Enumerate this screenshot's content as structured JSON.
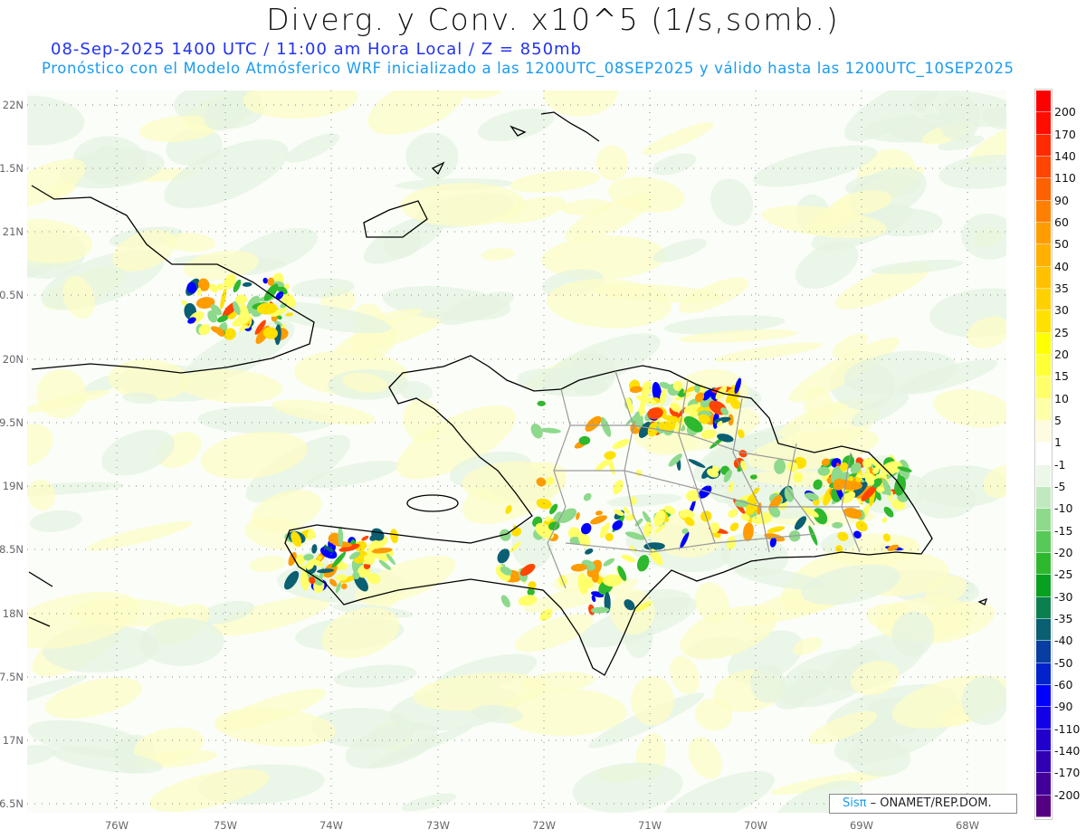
{
  "header": {
    "title": "Diverg. y Conv. x10^5 (1/s,somb.)",
    "subtitle": "08-Sep-2025  1400 UTC / 11:00 am Hora Local / Z = 850mb",
    "model_line": "Pronóstico con el Modelo Atmósferico WRF inicializado a las 1200UTC_08SEP2025 y válido hasta las  1200UTC_10SEP2025"
  },
  "axes": {
    "lat_labels": [
      "22N",
      "1.5N",
      "21N",
      "0.5N",
      "20N",
      "9.5N",
      "19N",
      "8.5N",
      "18N",
      "7.5N",
      "17N",
      "6.5N"
    ],
    "lon_labels": [
      "76W",
      "75W",
      "74W",
      "73W",
      "72W",
      "71W",
      "70W",
      "69W",
      "68W"
    ]
  },
  "colorbar": {
    "labels": [
      "200",
      "170",
      "140",
      "110",
      "90",
      "60",
      "50",
      "40",
      "35",
      "30",
      "25",
      "20",
      "15",
      "10",
      "5",
      "1",
      "-1",
      "-5",
      "-10",
      "-15",
      "-20",
      "-25",
      "-30",
      "-35",
      "-40",
      "-50",
      "-60",
      "-90",
      "-110",
      "-140",
      "-170",
      "-200"
    ],
    "colors": [
      "#ff0000",
      "#ff0d00",
      "#ff2a00",
      "#ff4500",
      "#ff6000",
      "#ff8000",
      "#ff9c00",
      "#ffb000",
      "#ffc000",
      "#ffd000",
      "#ffe000",
      "#ffff00",
      "#ffff35",
      "#ffff6a",
      "#ffffa8",
      "#fffbe0",
      "#ffffff",
      "#ecf7ea",
      "#c0e9c0",
      "#8ed98c",
      "#58c858",
      "#2eb82e",
      "#08a020",
      "#0b7f50",
      "#0a5f72",
      "#083ea2",
      "#0222cc",
      "#0000ff",
      "#1200e6",
      "#2200cc",
      "#3200b4",
      "#42009a",
      "#540082"
    ]
  },
  "credit": {
    "brand": "Sisπ",
    "text": "– ONAMET/REP.DOM."
  }
}
